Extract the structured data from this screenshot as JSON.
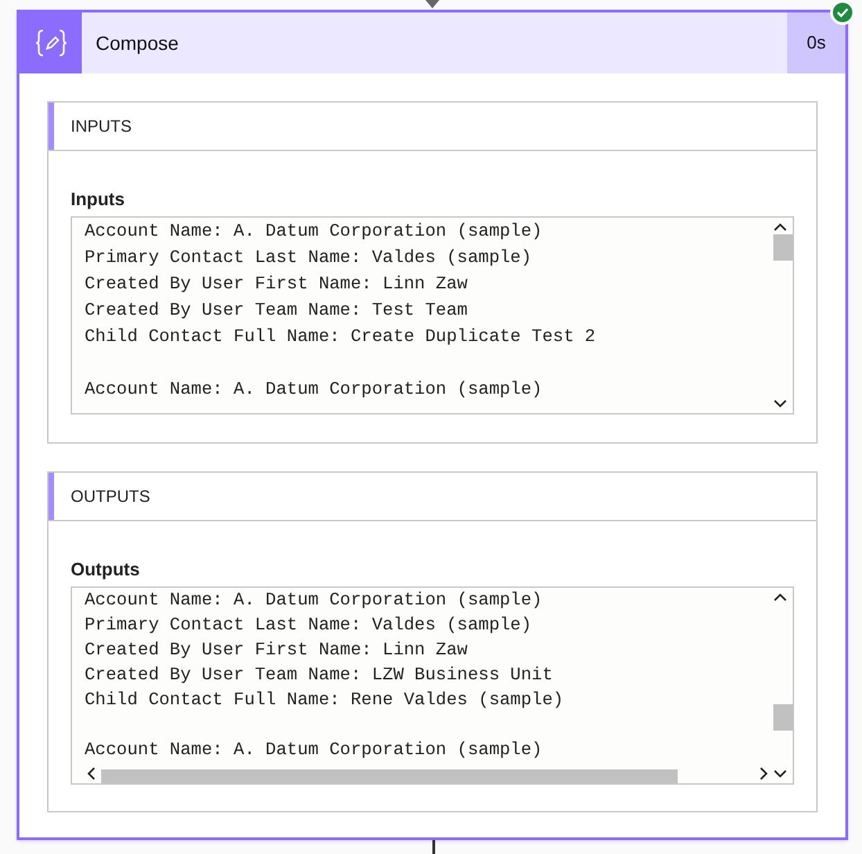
{
  "card": {
    "title": "Compose",
    "duration": "0s",
    "succeeded": true
  },
  "sections": [
    {
      "heading": "INPUTS",
      "label": "Inputs",
      "records": [
        [
          "Account Name: A. Datum Corporation (sample)",
          "Primary Contact Last Name: Valdes (sample)",
          "Created By User First Name: Linn Zaw",
          "Created By User Team Name: Test Team",
          "Child Contact Full Name: Create Duplicate Test 2"
        ],
        [
          "Account Name: A. Datum Corporation (sample)"
        ]
      ]
    },
    {
      "heading": "OUTPUTS",
      "label": "Outputs",
      "records": [
        [
          "Account Name: A. Datum Corporation (sample)",
          "Primary Contact Last Name: Valdes (sample)",
          "Created By User First Name: Linn Zaw",
          "Created By User Team Name: LZW Business Unit",
          "Child Contact Full Name: Rene Valdes (sample)"
        ],
        [
          "Account Name: A. Datum Corporation (sample)"
        ]
      ]
    }
  ]
}
